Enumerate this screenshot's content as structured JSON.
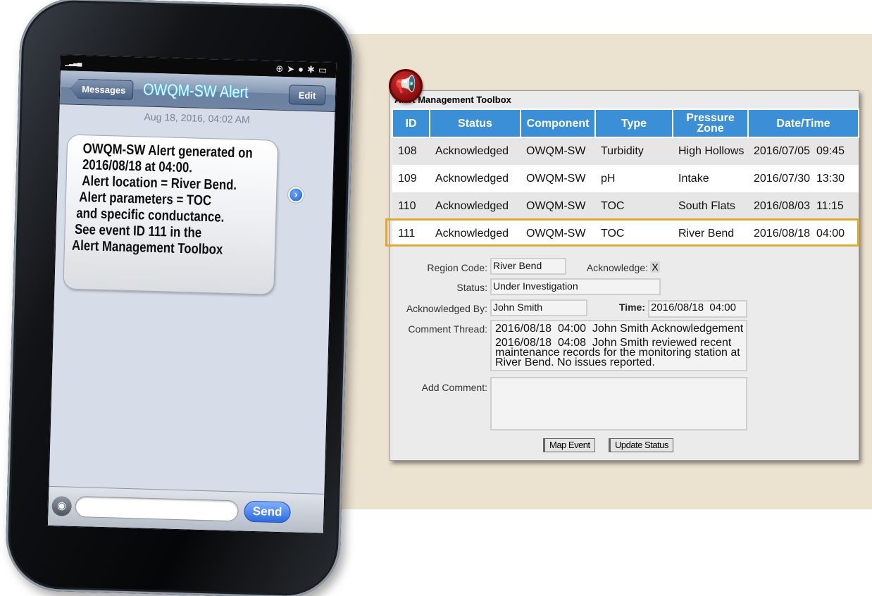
{
  "phone": {
    "nav_back_label": "Messages",
    "nav_title": "OWQM-SW Alert",
    "nav_edit_label": "Edit",
    "message_date": "Aug 18, 2016, 04:02 AM",
    "message_lines": [
      "OWQM-SW Alert generated on",
      "2016/08/18 at 04:00.",
      "Alert location = River Bend.",
      "Alert parameters = TOC",
      "and specific conductance.",
      "See event ID 111 in the",
      "Alert Management Toolbox"
    ],
    "send_label": "Send"
  },
  "toolbox": {
    "title": "Alert Management Toolbox",
    "columns": [
      "ID",
      "Status",
      "Component",
      "Type",
      "Pressure Zone",
      "Date/Time"
    ],
    "rows": [
      [
        "108",
        "Acknowledged",
        "OWQM-SW",
        "Turbidity",
        "High Hollows",
        "2016/07/05  09:45"
      ],
      [
        "109",
        "Acknowledged",
        "OWQM-SW",
        "pH",
        "Intake",
        "2016/07/30  13:30"
      ],
      [
        "110",
        "Acknowledged",
        "OWQM-SW",
        "TOC",
        "South Flats",
        "2016/08/03  11:15"
      ],
      [
        "111",
        "Acknowledged",
        "OWQM-SW",
        "TOC",
        "River Bend",
        "2016/08/18  04:00"
      ]
    ],
    "highlight_color": "#e3a82b",
    "header_color": "#3a8fd6",
    "form": {
      "region_code_label": "Region Code:",
      "region_code_value": "River Bend",
      "acknowledge_label": "Acknowledge:",
      "acknowledge_value": "X",
      "status_label": "Status:",
      "status_value": "Under Investigation",
      "ack_by_label": "Acknowledged By:",
      "ack_by_value": "John Smith",
      "time_label": "Time:",
      "time_value": "2016/08/18  04:00",
      "thread_label": "Comment Thread:",
      "thread_1": "2016/08/18  04:00  John Smith Acknowledgement",
      "thread_2a": "2016/08/18  04:08  John Smith reviewed recent",
      "thread_2b": "maintenance records for the monitoring station at",
      "thread_2c": "River Bend. No issues reported.",
      "add_comment_label": "Add Comment:",
      "add_comment_value": ""
    },
    "buttons": {
      "map_event": "Map Event",
      "update_status": "Update Status"
    }
  }
}
